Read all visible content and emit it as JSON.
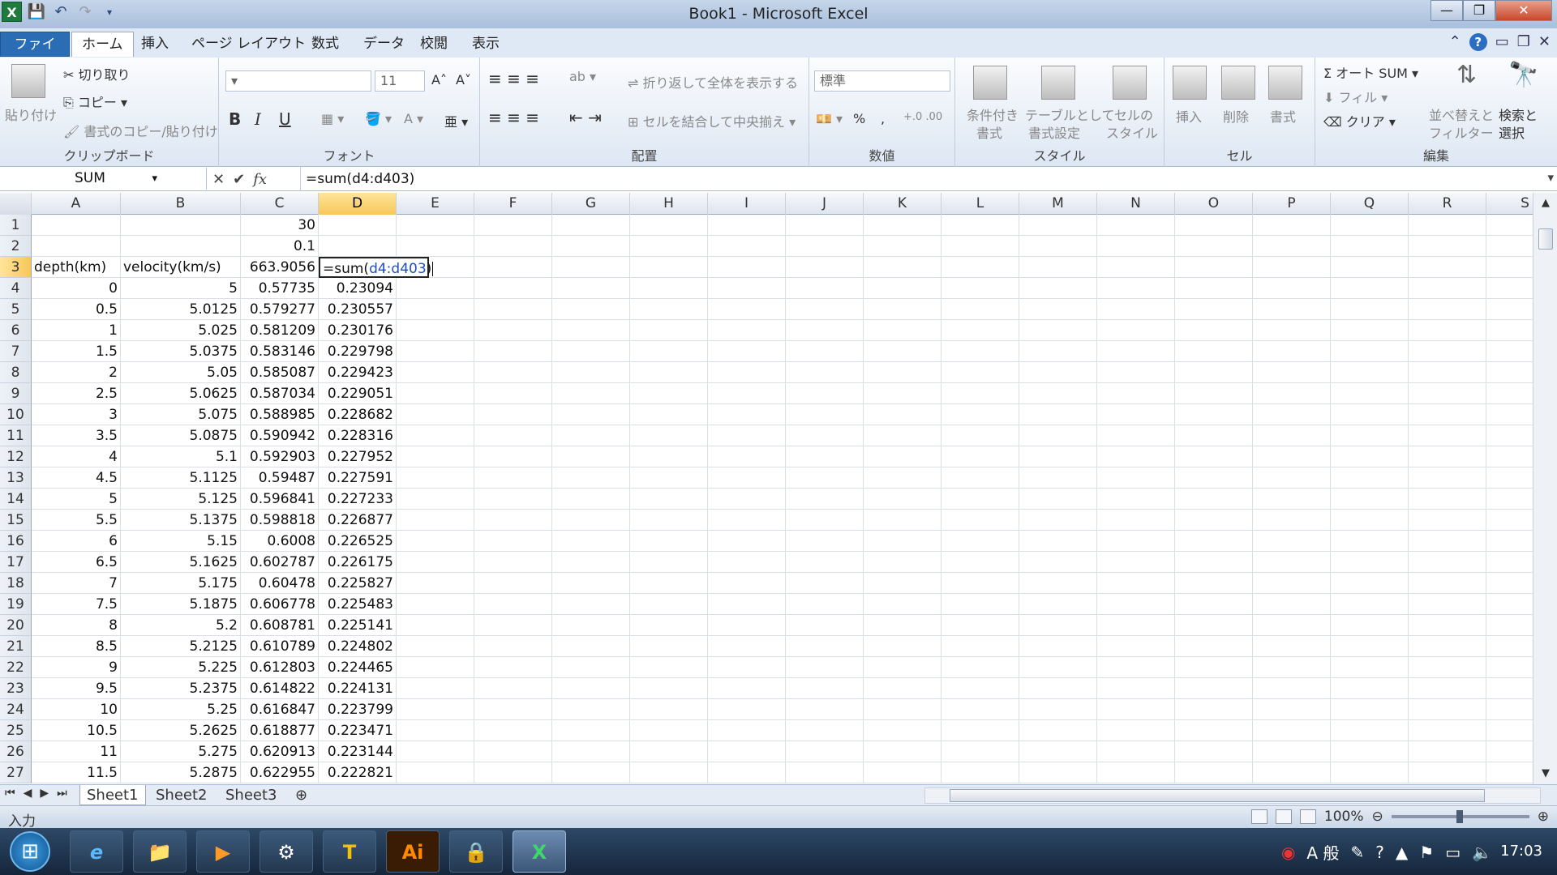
{
  "window": {
    "title": "Book1 - Microsoft Excel",
    "minimize": "—",
    "restore": "❐",
    "close": "✕"
  },
  "qat": {
    "logo": "X",
    "save_icon": "save-icon",
    "undo_icon": "undo-icon",
    "redo_icon": "redo-icon"
  },
  "tabs": [
    "ファイル",
    "ホーム",
    "挿入",
    "ページ レイアウト",
    "数式",
    "データ",
    "校閲",
    "表示"
  ],
  "ribbon": {
    "clipboard": {
      "paste": "貼り付け",
      "cut": "切り取り",
      "copy": "コピー",
      "format_painter": "書式のコピー/貼り付け",
      "label": "クリップボード"
    },
    "font": {
      "size": "11",
      "bold": "B",
      "italic": "I",
      "underline": "U",
      "grow": "A˄",
      "shrink": "A˅",
      "label": "フォント"
    },
    "alignment": {
      "wrap": "折り返して全体を表示する",
      "merge": "セルを結合して中央揃え",
      "label": "配置"
    },
    "number": {
      "format": "標準",
      "percent": "%",
      "comma": ",",
      "label": "数値"
    },
    "styles": {
      "conditional_1": "条件付き",
      "conditional_2": "書式",
      "table_1": "テーブルとして",
      "table_2": "書式設定",
      "cell_1": "セルの",
      "cell_2": "スタイル",
      "label": "スタイル"
    },
    "cells": {
      "insert": "挿入",
      "delete": "削除",
      "format": "書式",
      "label": "セル"
    },
    "editing": {
      "autosum": "Σ オート SUM",
      "fill": "フィル",
      "clear": "クリア",
      "sort_1": "並べ替えと",
      "sort_2": "フィルター",
      "find_1": "検索と",
      "find_2": "選択",
      "label": "編集"
    }
  },
  "formula_bar": {
    "name_box": "SUM",
    "cancel": "✕",
    "enter": "✔",
    "fx": "fx",
    "formula": "=sum(d4:d403)"
  },
  "columns": [
    "A",
    "B",
    "C",
    "D",
    "E",
    "F",
    "G",
    "H",
    "I",
    "J",
    "K",
    "L",
    "M",
    "N",
    "O",
    "P",
    "Q",
    "R",
    "S"
  ],
  "grid": {
    "rows": [
      {
        "n": "1",
        "a": "",
        "b": "",
        "c": "30",
        "d": ""
      },
      {
        "n": "2",
        "a": "",
        "b": "",
        "c": "0.1",
        "d": ""
      },
      {
        "n": "3",
        "a": "depth(km)",
        "b": "velocity(km/s)",
        "c": "663.9056",
        "d": ""
      },
      {
        "n": "4",
        "a": "0",
        "b": "5",
        "c": "0.57735",
        "d": "0.23094"
      },
      {
        "n": "5",
        "a": "0.5",
        "b": "5.0125",
        "c": "0.579277",
        "d": "0.230557"
      },
      {
        "n": "6",
        "a": "1",
        "b": "5.025",
        "c": "0.581209",
        "d": "0.230176"
      },
      {
        "n": "7",
        "a": "1.5",
        "b": "5.0375",
        "c": "0.583146",
        "d": "0.229798"
      },
      {
        "n": "8",
        "a": "2",
        "b": "5.05",
        "c": "0.585087",
        "d": "0.229423"
      },
      {
        "n": "9",
        "a": "2.5",
        "b": "5.0625",
        "c": "0.587034",
        "d": "0.229051"
      },
      {
        "n": "10",
        "a": "3",
        "b": "5.075",
        "c": "0.588985",
        "d": "0.228682"
      },
      {
        "n": "11",
        "a": "3.5",
        "b": "5.0875",
        "c": "0.590942",
        "d": "0.228316"
      },
      {
        "n": "12",
        "a": "4",
        "b": "5.1",
        "c": "0.592903",
        "d": "0.227952"
      },
      {
        "n": "13",
        "a": "4.5",
        "b": "5.1125",
        "c": "0.59487",
        "d": "0.227591"
      },
      {
        "n": "14",
        "a": "5",
        "b": "5.125",
        "c": "0.596841",
        "d": "0.227233"
      },
      {
        "n": "15",
        "a": "5.5",
        "b": "5.1375",
        "c": "0.598818",
        "d": "0.226877"
      },
      {
        "n": "16",
        "a": "6",
        "b": "5.15",
        "c": "0.6008",
        "d": "0.226525"
      },
      {
        "n": "17",
        "a": "6.5",
        "b": "5.1625",
        "c": "0.602787",
        "d": "0.226175"
      },
      {
        "n": "18",
        "a": "7",
        "b": "5.175",
        "c": "0.60478",
        "d": "0.225827"
      },
      {
        "n": "19",
        "a": "7.5",
        "b": "5.1875",
        "c": "0.606778",
        "d": "0.225483"
      },
      {
        "n": "20",
        "a": "8",
        "b": "5.2",
        "c": "0.608781",
        "d": "0.225141"
      },
      {
        "n": "21",
        "a": "8.5",
        "b": "5.2125",
        "c": "0.610789",
        "d": "0.224802"
      },
      {
        "n": "22",
        "a": "9",
        "b": "5.225",
        "c": "0.612803",
        "d": "0.224465"
      },
      {
        "n": "23",
        "a": "9.5",
        "b": "5.2375",
        "c": "0.614822",
        "d": "0.224131"
      },
      {
        "n": "24",
        "a": "10",
        "b": "5.25",
        "c": "0.616847",
        "d": "0.223799"
      },
      {
        "n": "25",
        "a": "10.5",
        "b": "5.2625",
        "c": "0.618877",
        "d": "0.223471"
      },
      {
        "n": "26",
        "a": "11",
        "b": "5.275",
        "c": "0.620913",
        "d": "0.223144"
      },
      {
        "n": "27",
        "a": "11.5",
        "b": "5.2875",
        "c": "0.622955",
        "d": "0.222821"
      }
    ],
    "editing_cell": {
      "prefix": "=sum(",
      "ref": "d4:d403",
      "suffix": ")"
    }
  },
  "sheets": [
    "Sheet1",
    "Sheet2",
    "Sheet3"
  ],
  "status": {
    "mode": "入力",
    "zoom": "100%"
  },
  "taskbar": {
    "start_icon": "windows-start-icon",
    "apps": [
      "e",
      "📁",
      "▶",
      "⚙",
      "T",
      "Ai",
      "🔒",
      "X"
    ],
    "tray_text": "A 般",
    "clock": "17:03"
  },
  "colors": {
    "selected_header": "#f6c75a",
    "file_tab": "#2a6db5",
    "ref_blue": "#1f4fbf"
  }
}
